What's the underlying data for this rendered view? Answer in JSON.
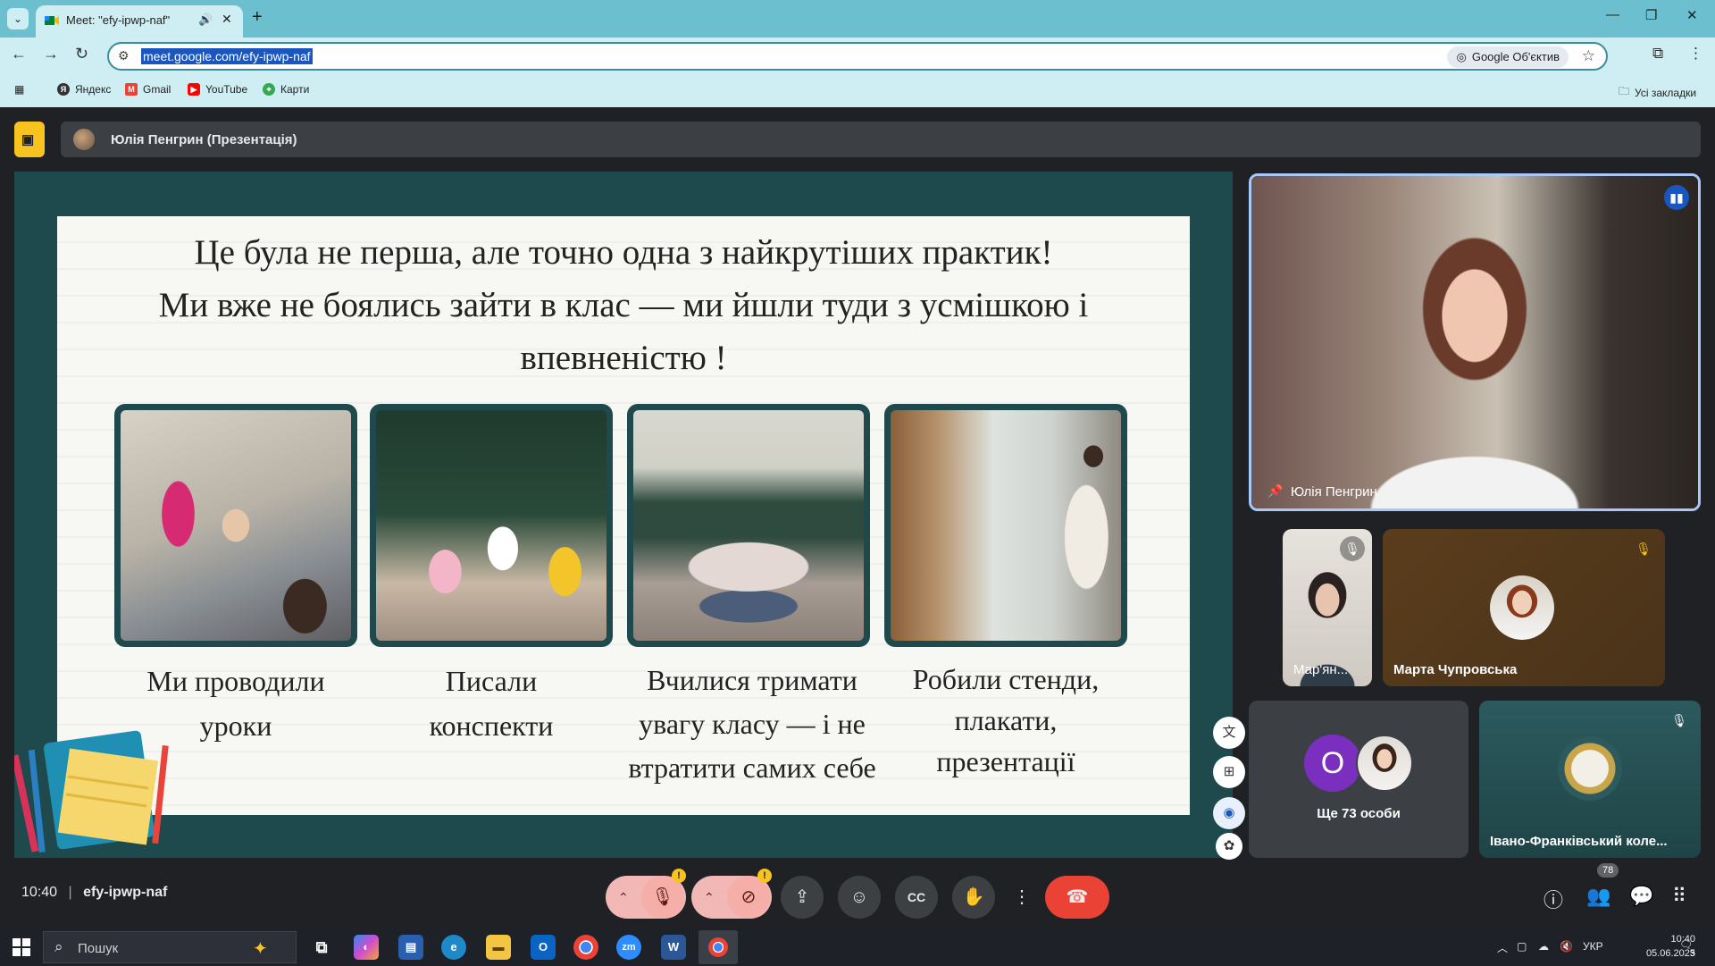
{
  "browser": {
    "tab_title": "Meet: \"efy-ipwp-naf\"",
    "url": "meet.google.com/efy-ipwp-naf",
    "lens_label": "Google Об'єктив",
    "bookmarks": [
      "Яндекс",
      "Gmail",
      "YouTube",
      "Карти"
    ],
    "all_bookmarks": "Усі закладки"
  },
  "meet": {
    "presenter_label": "Юлія Пенгрин (Презентація)",
    "meeting_time": "10:40",
    "meeting_code": "efy-ipwp-naf",
    "people_count": "78"
  },
  "slide": {
    "headline": [
      "Це була не перша, але точно одна з найкрутіших практик!",
      "Ми вже не боялись зайти в клас — ми йшли туди з усмішкою і",
      "впевненістю !"
    ],
    "captions": [
      [
        "Ми проводили",
        "уроки"
      ],
      [
        "Писали",
        "конспекти"
      ],
      [
        "Вчилися тримати",
        "увагу класу — і не",
        "втратити самих себе"
      ],
      [
        "Робили стенди,",
        "плакати,",
        "презентації"
      ]
    ]
  },
  "participants": {
    "main": "Юлія Пенгрин",
    "small1": "Мар'ян...",
    "small2": "Марта Чупровська",
    "others_initial": "О",
    "others_label": "Ще 73 особи",
    "college": "Івано-Франківський коле..."
  },
  "taskbar": {
    "search_placeholder": "Пошук",
    "lang": "УКР",
    "time": "10:40",
    "date": "05.06.2025",
    "notif_count": "3"
  },
  "colors": {
    "slide_frame": "#1e4a4d",
    "chrome_teal": "#6bbfce",
    "end_call": "#ea4335",
    "present_yellow": "#f9c31f"
  }
}
